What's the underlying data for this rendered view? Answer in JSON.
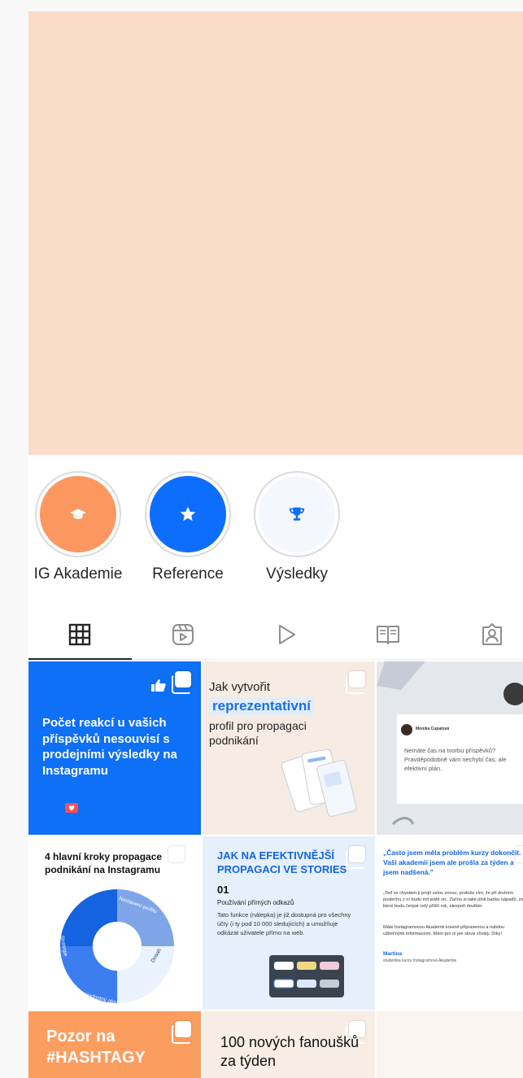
{
  "highlights": [
    {
      "label": "IG Akademie",
      "color": "#fc9760",
      "icon": "graduation-cap-icon"
    },
    {
      "label": "Reference",
      "color": "#0d6efd",
      "icon": "star-icon"
    },
    {
      "label": "Výsledky",
      "color": "#f4f8fe",
      "icon": "trophy-icon"
    }
  ],
  "tabs": [
    {
      "name": "posts-grid",
      "icon": "grid-icon",
      "active": true
    },
    {
      "name": "reels",
      "icon": "reels-icon",
      "active": false
    },
    {
      "name": "videos",
      "icon": "play-icon",
      "active": false
    },
    {
      "name": "guides",
      "icon": "guide-icon",
      "active": false
    },
    {
      "name": "tagged",
      "icon": "tagged-person-icon",
      "active": false
    }
  ],
  "posts": {
    "p1": {
      "title": "Počet reakcí u vašich příspěvků nesouvisí s prodejními výsledky na Instagramu"
    },
    "p2": {
      "line1": "Jak vytvořit",
      "highlight": "reprezentativní",
      "line3": "profil pro propagaci podnikání"
    },
    "p3": {
      "name": "Monika Cupalová",
      "text": "Nemáte čas na tvorbu příspěvků? Pravděpodobně vám nechybí čas, ale efektivní plán."
    },
    "p4": {
      "title": "4 hlavní kroky propagace podnikání na Instagramu",
      "segments": [
        "Nastavení profilu",
        "Dosah",
        "Hodnotný obsah",
        "Strategie"
      ]
    },
    "p5": {
      "title": "JAK NA EFEKTIVNĚJŠÍ PROPAGACI VE STORIES",
      "number": "01",
      "subtitle": "Používání přímých odkazů",
      "body": "Tato funkce (nálepka) je již dostupná pro všechny účty (i ty pod 10 000 sledujících) a umožňuje odkázat uživatele přímo na web."
    },
    "p6": {
      "quote": "„Často jsem měla problém kurzy dokončit. Vaši akademií jsem ale prošla za týden a jsem nadšená.\"",
      "body1": "„Teď se chystám ji projít celou znovu, protože vím, že při druhém poslechu z ní budu mít ještě víc. Začnu si také plnit banku nápadů, ze které budu čerpat celý příští rok, alespoň doufám.",
      "body2": "Máte Instagramovou Akademii krásně připravenou a nabitou užitečnými informacemi. Mám pro ni jen slova chvály. Díky!",
      "author": "Martina",
      "author_role": "studentka kurzu Instagramová Akademie"
    },
    "p7": {
      "title": "Pozor na #HASHTAGY"
    },
    "p8": {
      "title": "100 nových fanoušků za týden"
    }
  }
}
